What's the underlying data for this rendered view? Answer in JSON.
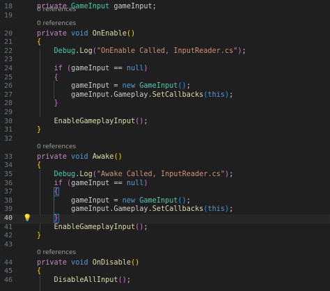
{
  "editor": {
    "reference_label": "0 references",
    "lines": [
      {
        "number": "18",
        "tokens": [
          {
            "t": "private",
            "c": "kw"
          },
          {
            "t": " ",
            "c": "id"
          },
          {
            "t": "GameInput",
            "c": "type"
          },
          {
            "t": " gameInput;",
            "c": "id"
          }
        ]
      },
      {
        "number": "19",
        "tokens": []
      },
      {
        "ref": true
      },
      {
        "number": "20",
        "tokens": [
          {
            "t": "private",
            "c": "kw"
          },
          {
            "t": " ",
            "c": "id"
          },
          {
            "t": "void",
            "c": "kwb"
          },
          {
            "t": " ",
            "c": "id"
          },
          {
            "t": "OnEnable",
            "c": "fn"
          },
          {
            "t": "()",
            "c": "br1"
          }
        ]
      },
      {
        "number": "21",
        "tokens": [
          {
            "t": "{",
            "c": "br1"
          }
        ]
      },
      {
        "number": "22",
        "tokens": [
          {
            "t": "    ",
            "c": "id"
          },
          {
            "t": "Debug",
            "c": "type"
          },
          {
            "t": ".",
            "c": "id"
          },
          {
            "t": "Log",
            "c": "fn"
          },
          {
            "t": "(",
            "c": "br2"
          },
          {
            "t": "\"OnEnable Called, InputReader.cs\"",
            "c": "str"
          },
          {
            "t": ")",
            "c": "br2"
          },
          {
            "t": ";",
            "c": "id"
          }
        ]
      },
      {
        "number": "23",
        "tokens": []
      },
      {
        "number": "24",
        "tokens": [
          {
            "t": "    ",
            "c": "id"
          },
          {
            "t": "if",
            "c": "kw"
          },
          {
            "t": " ",
            "c": "id"
          },
          {
            "t": "(",
            "c": "br2"
          },
          {
            "t": "gameInput == ",
            "c": "id"
          },
          {
            "t": "null",
            "c": "kwb"
          },
          {
            "t": ")",
            "c": "br2"
          }
        ]
      },
      {
        "number": "25",
        "tokens": [
          {
            "t": "    ",
            "c": "id"
          },
          {
            "t": "{",
            "c": "br2"
          }
        ]
      },
      {
        "number": "26",
        "tokens": [
          {
            "t": "        gameInput = ",
            "c": "id"
          },
          {
            "t": "new",
            "c": "kwb"
          },
          {
            "t": " ",
            "c": "id"
          },
          {
            "t": "GameInput",
            "c": "type"
          },
          {
            "t": "()",
            "c": "br3"
          },
          {
            "t": ";",
            "c": "id"
          }
        ]
      },
      {
        "number": "27",
        "tokens": [
          {
            "t": "        gameInput.",
            "c": "id"
          },
          {
            "t": "Gameplay",
            "c": "id"
          },
          {
            "t": ".",
            "c": "id"
          },
          {
            "t": "SetCallbacks",
            "c": "fn"
          },
          {
            "t": "(",
            "c": "br3"
          },
          {
            "t": "this",
            "c": "kwb"
          },
          {
            "t": ")",
            "c": "br3"
          },
          {
            "t": ";",
            "c": "id"
          }
        ]
      },
      {
        "number": "28",
        "tokens": [
          {
            "t": "    ",
            "c": "id"
          },
          {
            "t": "}",
            "c": "br2"
          }
        ]
      },
      {
        "number": "29",
        "tokens": []
      },
      {
        "number": "30",
        "tokens": [
          {
            "t": "    ",
            "c": "id"
          },
          {
            "t": "EnableGameplayInput",
            "c": "fn"
          },
          {
            "t": "()",
            "c": "br2"
          },
          {
            "t": ";",
            "c": "id"
          }
        ]
      },
      {
        "number": "31",
        "tokens": [
          {
            "t": "}",
            "c": "br1"
          }
        ]
      },
      {
        "number": "32",
        "tokens": []
      },
      {
        "ref": true
      },
      {
        "number": "33",
        "tokens": [
          {
            "t": "private",
            "c": "kw"
          },
          {
            "t": " ",
            "c": "id"
          },
          {
            "t": "void",
            "c": "kwb"
          },
          {
            "t": " ",
            "c": "id"
          },
          {
            "t": "Awake",
            "c": "fn"
          },
          {
            "t": "()",
            "c": "br1"
          }
        ]
      },
      {
        "number": "34",
        "tokens": [
          {
            "t": "{",
            "c": "br1"
          }
        ]
      },
      {
        "number": "35",
        "tokens": [
          {
            "t": "    ",
            "c": "id"
          },
          {
            "t": "Debug",
            "c": "type"
          },
          {
            "t": ".",
            "c": "id"
          },
          {
            "t": "Log",
            "c": "fn"
          },
          {
            "t": "(",
            "c": "br2"
          },
          {
            "t": "\"Awake Called, InputReader.cs\"",
            "c": "str"
          },
          {
            "t": ")",
            "c": "br2"
          },
          {
            "t": ";",
            "c": "id"
          }
        ]
      },
      {
        "number": "36",
        "tokens": [
          {
            "t": "    ",
            "c": "id"
          },
          {
            "t": "if",
            "c": "kw"
          },
          {
            "t": " ",
            "c": "id"
          },
          {
            "t": "(",
            "c": "br2"
          },
          {
            "t": "gameInput == ",
            "c": "id"
          },
          {
            "t": "null",
            "c": "kwb"
          },
          {
            "t": ")",
            "c": "br2"
          }
        ]
      },
      {
        "number": "37",
        "tokens": [
          {
            "t": "    ",
            "c": "id"
          },
          {
            "t": "{",
            "c": "br2",
            "box": true
          }
        ]
      },
      {
        "number": "38",
        "tokens": [
          {
            "t": "        gameInput = ",
            "c": "id"
          },
          {
            "t": "new",
            "c": "kwb"
          },
          {
            "t": " ",
            "c": "id"
          },
          {
            "t": "GameInput",
            "c": "type"
          },
          {
            "t": "()",
            "c": "br3"
          },
          {
            "t": ";",
            "c": "id"
          }
        ]
      },
      {
        "number": "39",
        "tokens": [
          {
            "t": "        gameInput.",
            "c": "id"
          },
          {
            "t": "Gameplay",
            "c": "id"
          },
          {
            "t": ".",
            "c": "id"
          },
          {
            "t": "SetCallbacks",
            "c": "fn"
          },
          {
            "t": "(",
            "c": "br3"
          },
          {
            "t": "this",
            "c": "kwb"
          },
          {
            "t": ")",
            "c": "br3"
          },
          {
            "t": ";",
            "c": "id"
          }
        ]
      },
      {
        "number": "40",
        "current": true,
        "tokens": [
          {
            "t": "    ",
            "c": "id"
          },
          {
            "t": "}",
            "c": "br2",
            "box": true
          }
        ]
      },
      {
        "number": "41",
        "tokens": [
          {
            "t": "    ",
            "c": "id"
          },
          {
            "t": "EnableGameplayInput",
            "c": "fn"
          },
          {
            "t": "()",
            "c": "br2"
          },
          {
            "t": ";",
            "c": "id"
          }
        ]
      },
      {
        "number": "42",
        "tokens": [
          {
            "t": "}",
            "c": "br1"
          }
        ]
      },
      {
        "number": "43",
        "tokens": []
      },
      {
        "ref": true
      },
      {
        "number": "44",
        "tokens": [
          {
            "t": "private",
            "c": "kw"
          },
          {
            "t": " ",
            "c": "id"
          },
          {
            "t": "void",
            "c": "kwb"
          },
          {
            "t": " ",
            "c": "id"
          },
          {
            "t": "OnDisable",
            "c": "fn"
          },
          {
            "t": "()",
            "c": "br1"
          }
        ]
      },
      {
        "number": "45",
        "tokens": [
          {
            "t": "{",
            "c": "br1"
          }
        ]
      },
      {
        "number": "46",
        "tokens": [
          {
            "t": "    ",
            "c": "id"
          },
          {
            "t": "DisableAllInput",
            "c": "fn"
          },
          {
            "t": "()",
            "c": "br2"
          },
          {
            "t": ";",
            "c": "id"
          }
        ]
      }
    ]
  },
  "lightbulb_icon": "lightbulb-icon"
}
